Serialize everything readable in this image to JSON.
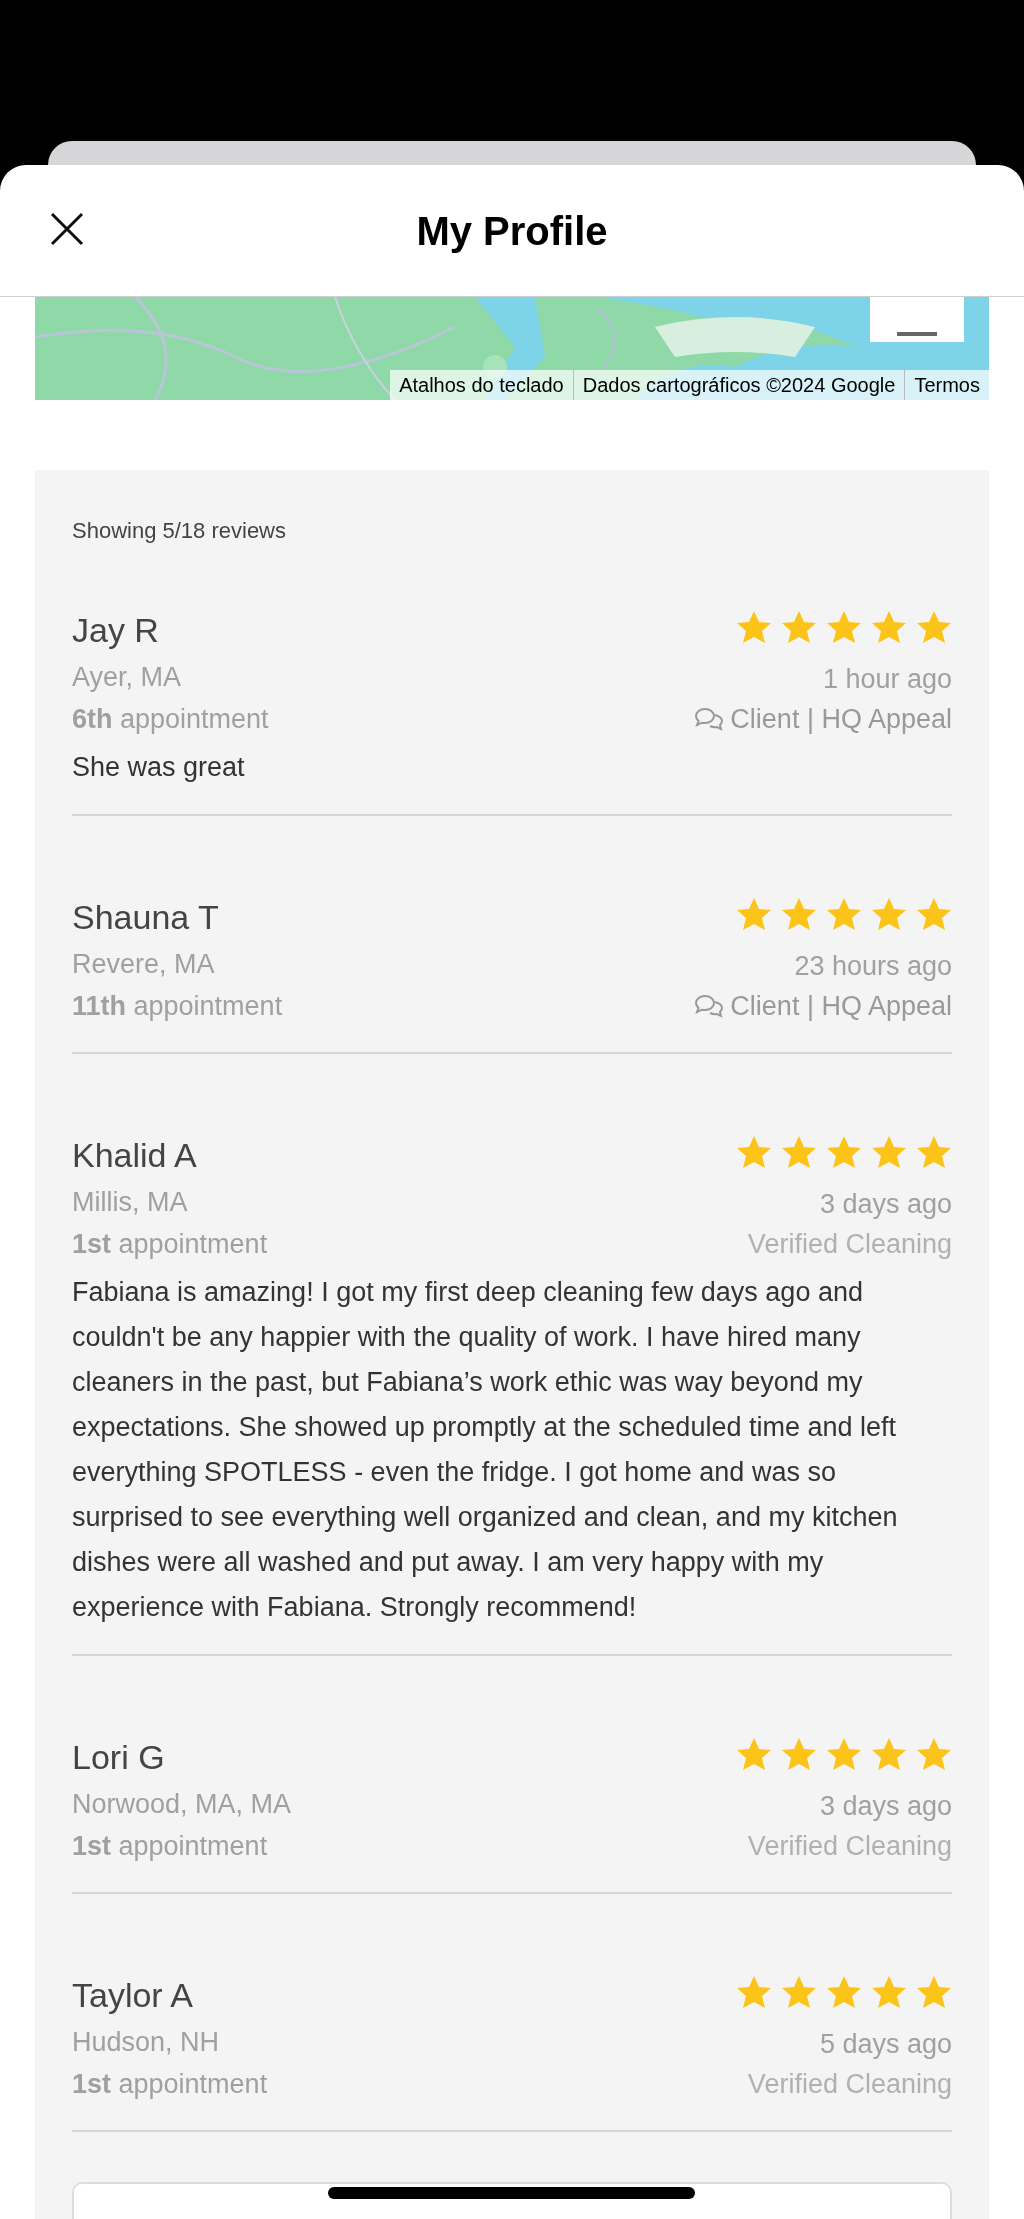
{
  "header": {
    "title": "My Profile"
  },
  "map": {
    "attribution": [
      "Atalhos do teclado",
      "Dados cartográficos ©2024 Google",
      "Termos"
    ]
  },
  "reviews_summary": "Showing 5/18 reviews",
  "reviews": [
    {
      "name": "Jay R",
      "location": "Ayer, MA",
      "appointment": "**6th** appointment",
      "stars": 5,
      "time": "1 hour ago",
      "kind": "appeal",
      "source": "Client | HQ Appeal",
      "text": "She was great"
    },
    {
      "name": "Shauna T",
      "location": "Revere, MA",
      "appointment": "**11th** appointment",
      "stars": 5,
      "time": "23 hours ago",
      "kind": "appeal",
      "source": "Client | HQ Appeal"
    },
    {
      "name": "Khalid A",
      "location": "Millis, MA",
      "appointment": "**1st** appointment",
      "stars": 5,
      "time": "3 days ago",
      "kind": "verified",
      "source": "Verified Cleaning",
      "text": "Fabiana is amazing! I got my first deep cleaning few days ago and couldn't be any happier with the quality of work. I have hired many cleaners in the past, but Fabiana’s work ethic was way beyond my expectations. She showed up promptly at the scheduled time and left everything SPOTLESS - even the fridge. I got home and was so surprised to see everything well organized and clean, and my kitchen dishes were all washed and put away. I am very happy with my experience with Fabiana. Strongly recommend!"
    },
    {
      "name": "Lori G",
      "location": "Norwood, MA, MA",
      "appointment": "**1st** appointment",
      "stars": 5,
      "time": "3 days ago",
      "kind": "verified",
      "source": "Verified Cleaning"
    },
    {
      "name": "Taylor A",
      "location": "Hudson, NH",
      "appointment": "**1st** appointment",
      "stars": 5,
      "time": "5 days ago",
      "kind": "verified",
      "source": "Verified Cleaning"
    }
  ]
}
